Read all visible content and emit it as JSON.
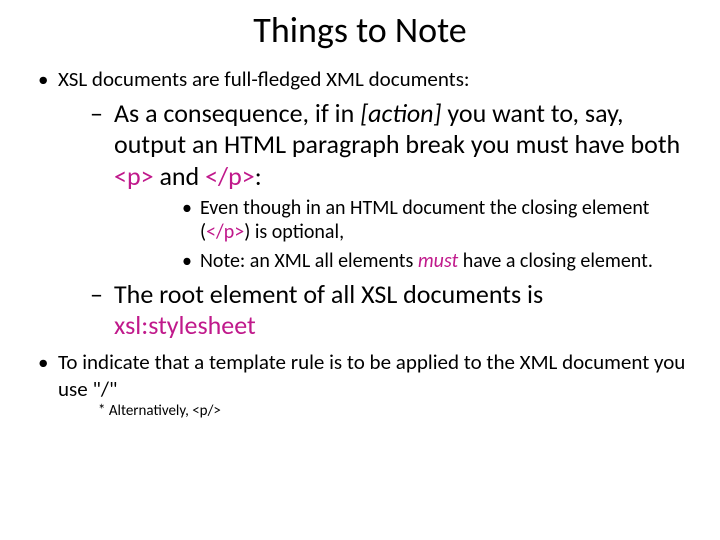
{
  "title": "Things to Note",
  "b1": "XSL documents are full-fledged XML documents:",
  "b1s1_a": "As a consequence, if in ",
  "b1s1_action": "[action]",
  "b1s1_b": " you want to, say, output an HTML paragraph break you must have both ",
  "b1s1_p": "<p>",
  "b1s1_and": " and ",
  "b1s1_cp": "</p>",
  "b1s1_colon": ":",
  "b1s1s1_a": "Even though in an HTML document the closing element (",
  "b1s1s1_cp": "</p>",
  "b1s1s1_b": ") is optional,",
  "b1s1s2_a": "Note: an XML all elements ",
  "b1s1s2_must": "must",
  "b1s1s2_b": " have a closing element.",
  "b1s2_a": "The root element of all XSL documents is ",
  "b1s2_xsl": "xsl:stylesheet",
  "b2": "To indicate that a template rule is to be applied to the XML document you use \"/\"",
  "footnote": "* Alternatively, <p/>"
}
